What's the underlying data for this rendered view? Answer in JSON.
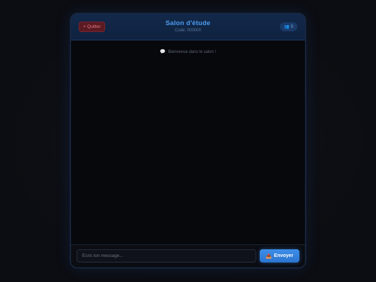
{
  "header": {
    "quit_icon": "×",
    "quit_label": "Quitter",
    "title": "Salon d'étude",
    "room_code": "Code: 000000",
    "members_icon": "👥",
    "members_count": "0"
  },
  "messages": {
    "welcome_icon": "💬",
    "welcome_text": "Bienvenue dans le salon !"
  },
  "composer": {
    "placeholder": "Écris ton message...",
    "value": "",
    "send_icon": "📤",
    "send_label": "Envoyer"
  },
  "colors": {
    "accent": "#3d8ee8",
    "title": "#4d9df2",
    "danger": "#e77c86",
    "background": "#08090d"
  }
}
